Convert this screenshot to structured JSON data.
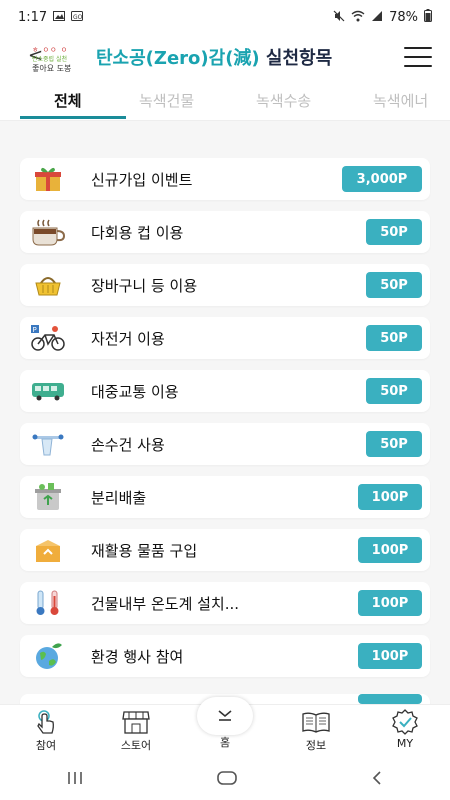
{
  "status_bar": {
    "time": "1:17",
    "battery": "78%"
  },
  "header": {
    "logo_text_1": "ㅎ ㅇㅇ ㅇ",
    "logo_text_2": "탄소중립 실천",
    "logo_text_3": "좋아요 도봉",
    "title_part1": "탄소공(Zero)감(減)",
    "title_part2": " 실천항목"
  },
  "tabs": [
    {
      "label": "전체"
    },
    {
      "label": "녹색건물"
    },
    {
      "label": "녹색수송"
    },
    {
      "label": "녹색에너"
    }
  ],
  "items": [
    {
      "label": "신규가입 이벤트",
      "points": "3,000P",
      "icon": "gift-icon"
    },
    {
      "label": "다회용 컵 이용",
      "points": "50P",
      "icon": "coffee-cup-icon"
    },
    {
      "label": "장바구니 등 이용",
      "points": "50P",
      "icon": "basket-icon"
    },
    {
      "label": "자전거 이용",
      "points": "50P",
      "icon": "bicycle-icon"
    },
    {
      "label": "대중교통 이용",
      "points": "50P",
      "icon": "bus-icon"
    },
    {
      "label": "손수건 사용",
      "points": "50P",
      "icon": "handkerchief-icon"
    },
    {
      "label": "분리배출",
      "points": "100P",
      "icon": "recycle-bin-icon"
    },
    {
      "label": "재활용 물품 구입",
      "points": "100P",
      "icon": "recycled-box-icon"
    },
    {
      "label": "건물내부 온도계 설치...",
      "points": "100P",
      "icon": "thermometer-icon"
    },
    {
      "label": "환경 행사 참여",
      "points": "100P",
      "icon": "earth-icon"
    }
  ],
  "bottom_nav": {
    "participate": "참여",
    "store": "스토어",
    "center": "홈",
    "info": "정보",
    "my": "MY"
  },
  "colors": {
    "accent": "#3ab0c0",
    "tab_underline": "#1a8c99",
    "title_teal": "#1aa3b0"
  }
}
